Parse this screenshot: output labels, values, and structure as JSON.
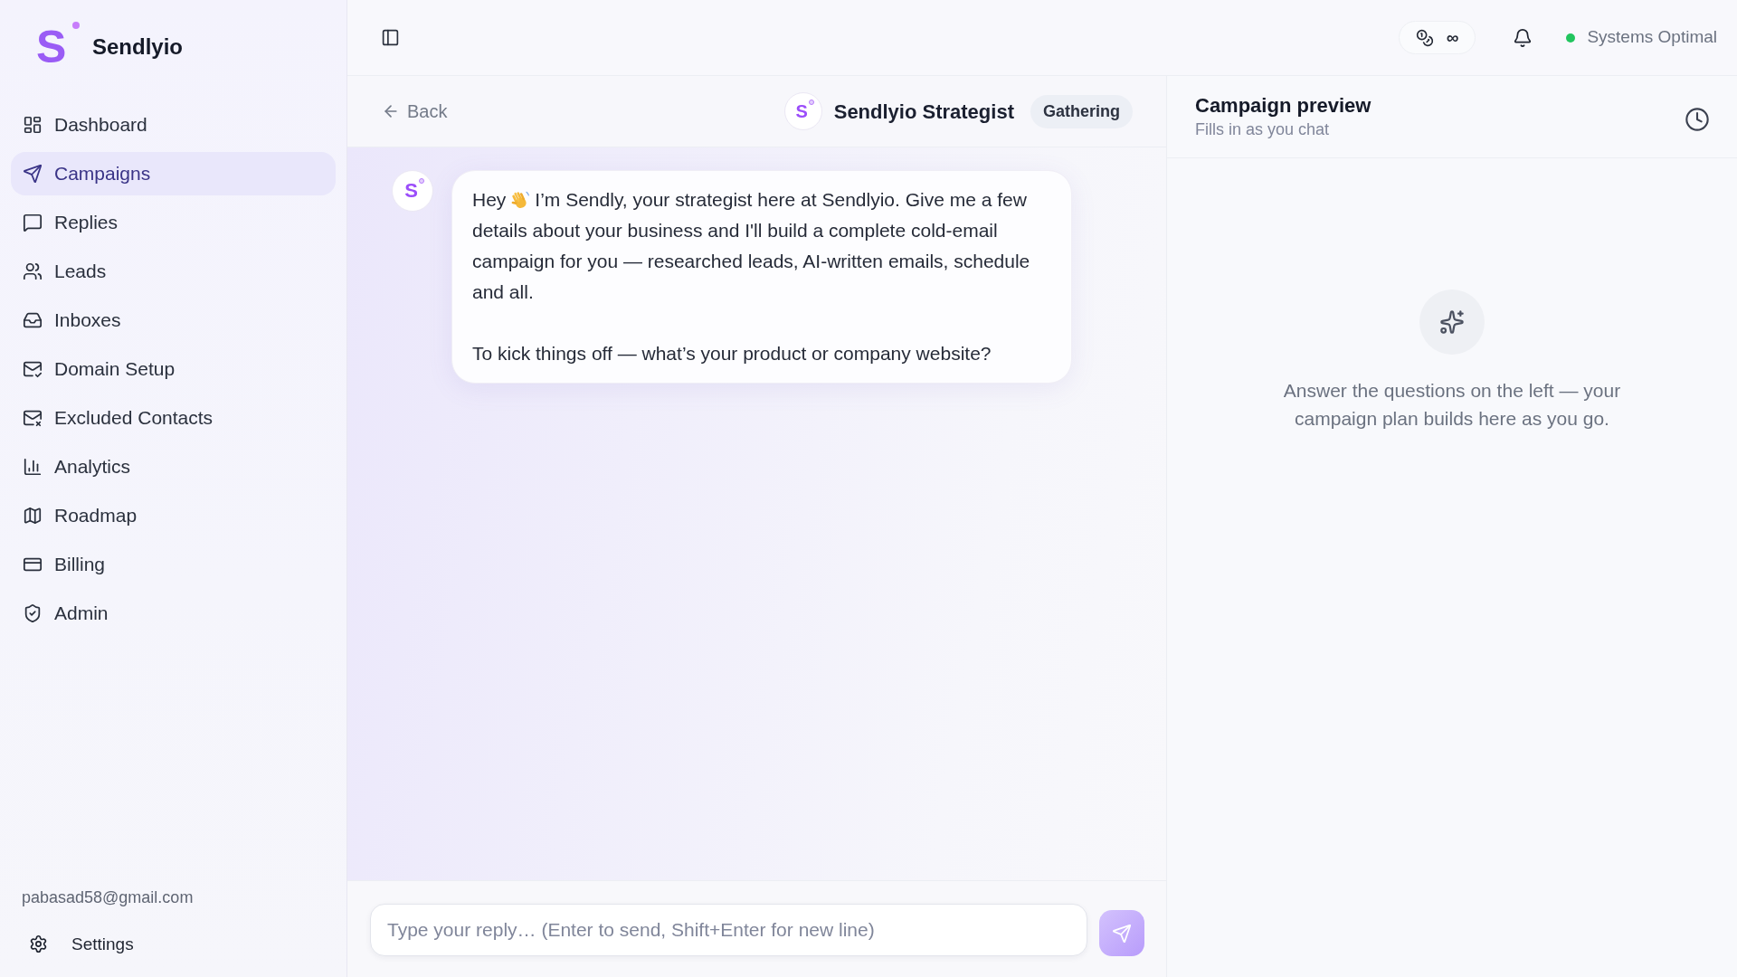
{
  "sidebar": {
    "brand": {
      "mark": "S",
      "name": "Sendlyio"
    },
    "items": [
      {
        "label": "Dashboard",
        "selected": false
      },
      {
        "label": "Campaigns",
        "selected": true
      },
      {
        "label": "Replies",
        "selected": false
      },
      {
        "label": "Leads",
        "selected": false
      },
      {
        "label": "Inboxes",
        "selected": false
      },
      {
        "label": "Domain Setup",
        "selected": false
      },
      {
        "label": "Excluded Contacts",
        "selected": false
      },
      {
        "label": "Analytics",
        "selected": false
      },
      {
        "label": "Roadmap",
        "selected": false
      },
      {
        "label": "Billing",
        "selected": false
      },
      {
        "label": "Admin",
        "selected": false
      }
    ],
    "account": {
      "email": "pabasad58@gmail.com"
    },
    "settings": {
      "label": "Settings"
    }
  },
  "topbar": {
    "credits": "∞",
    "status": {
      "label": "Systems Optimal",
      "healthy": true
    }
  },
  "chat": {
    "back": "Back",
    "agent": {
      "avatar": "S",
      "name": "Sendlyio Strategist",
      "stage": "Gathering"
    },
    "messages": [
      {
        "kind": "assistant",
        "avatar": "S",
        "greeting": "Hey",
        "text": "I’m Sendly, your strategist here at Sendlyio. Give me a few details about your business and I'll build a complete cold-email campaign for you — researched leads, AI-written emails, schedule and all.",
        "question": "To kick things off — what’s your product or company website?"
      }
    ],
    "composer": {
      "placeholder": "Type your reply… (Enter to send, Shift+Enter for new line)",
      "send_disabled": true
    }
  },
  "preview": {
    "title": "Campaign preview",
    "subtitle": "Fills in as you chat",
    "empty_message": "Answer the questions on the left — your campaign plan builds here as you go."
  }
}
